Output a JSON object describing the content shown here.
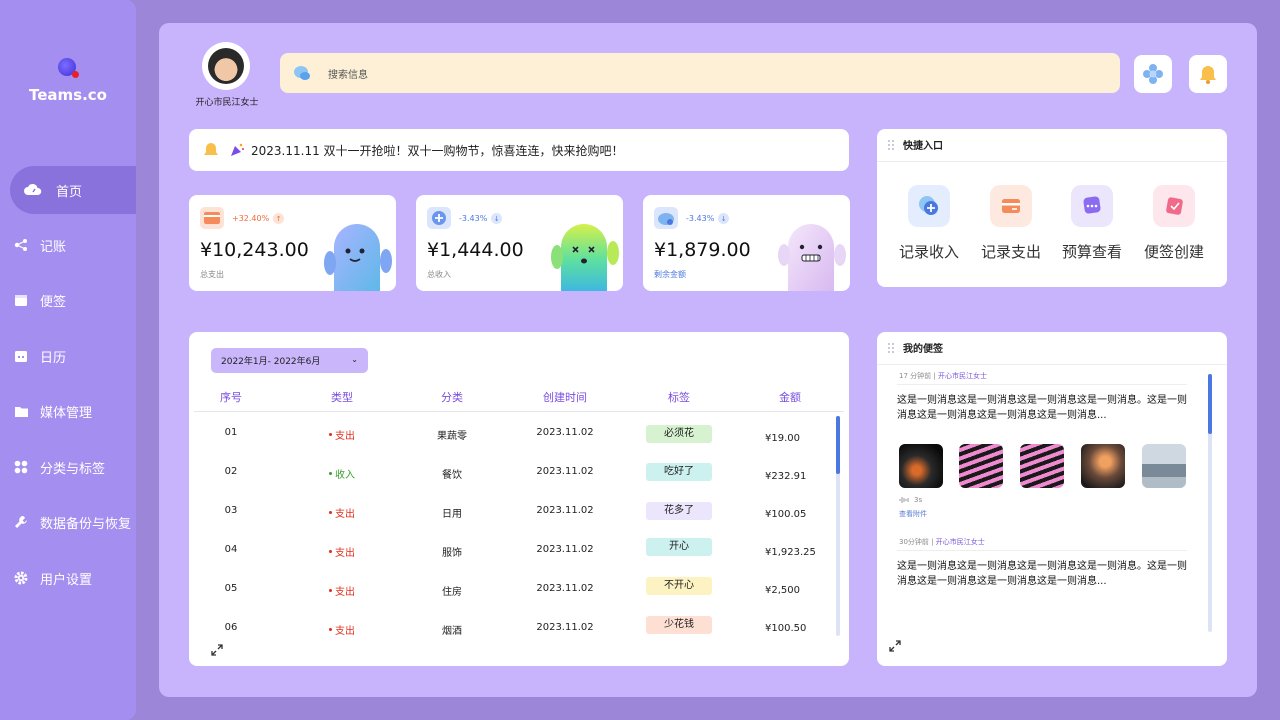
{
  "app": {
    "logo_text": "Teams.co"
  },
  "sidebar": {
    "items": [
      {
        "label": "首页",
        "icon": "cloud-icon",
        "active": true
      },
      {
        "label": "记账",
        "icon": "share-icon"
      },
      {
        "label": "便签",
        "icon": "calendar-icon"
      },
      {
        "label": "日历",
        "icon": "calendar-date-icon"
      },
      {
        "label": "媒体管理",
        "icon": "folder-icon"
      },
      {
        "label": "分类与标签",
        "icon": "grid-icon"
      },
      {
        "label": "数据备份与恢复",
        "icon": "wrench-icon"
      },
      {
        "label": "用户设置",
        "icon": "gear-icon"
      }
    ]
  },
  "header": {
    "user_name": "开心市民江女士",
    "search_placeholder": "搜索信息"
  },
  "notice": {
    "text": "2023.11.11 双十一开抢啦！双十一购物节，惊喜连连，快来抢购吧！"
  },
  "stats": [
    {
      "change": "+32.40%",
      "direction": "up",
      "amount": "¥10,243.00",
      "label": "总支出",
      "accent": "#f26b3a"
    },
    {
      "change": "-3.43%",
      "direction": "down",
      "amount": "¥1,444.00",
      "label": "总收入",
      "accent": "#4a78e0"
    },
    {
      "change": "-3.43%",
      "direction": "down",
      "amount": "¥1,879.00",
      "label": "剩余金额",
      "accent": "#4a78e0"
    }
  ],
  "quick_entry": {
    "title": "快捷入口",
    "items": [
      {
        "label": "记录收入",
        "icon": "add-income-icon"
      },
      {
        "label": "记录支出",
        "icon": "card-icon"
      },
      {
        "label": "预算查看",
        "icon": "chat-dots-icon"
      },
      {
        "label": "便签创建",
        "icon": "note-check-icon"
      }
    ]
  },
  "records": {
    "date_range": "2022年1月- 2022年6月",
    "columns": [
      "序号",
      "类型",
      "分类",
      "创建时间",
      "标签",
      "金额"
    ],
    "rows": [
      {
        "no": "01",
        "type": "支出",
        "category": "果蔬零",
        "time": "2023.11.02",
        "tag": "必须花",
        "tag_color": "#d7f2d0",
        "amount": "¥19.00"
      },
      {
        "no": "02",
        "type": "收入",
        "category": "餐饮",
        "time": "2023.11.02",
        "tag": "吃好了",
        "tag_color": "#cdf1ee",
        "amount": "¥232.91"
      },
      {
        "no": "03",
        "type": "支出",
        "category": "日用",
        "time": "2023.11.02",
        "tag": "花多了",
        "tag_color": "#ece6fc",
        "amount": "¥100.05"
      },
      {
        "no": "04",
        "type": "支出",
        "category": "服饰",
        "time": "2023.11.02",
        "tag": "开心",
        "tag_color": "#cdf1ee",
        "amount": "¥1,923.25"
      },
      {
        "no": "05",
        "type": "支出",
        "category": "住房",
        "time": "2023.11.02",
        "tag": "不开心",
        "tag_color": "#fdf3c2",
        "amount": "¥2,500"
      },
      {
        "no": "06",
        "type": "支出",
        "category": "烟酒",
        "time": "2023.11.02",
        "tag": "少花钱",
        "tag_color": "#fde0d3",
        "amount": "¥100.50"
      }
    ],
    "colors": {
      "expense": "#e0301e",
      "income": "#3aa02c"
    }
  },
  "memos": {
    "title": "我的便签",
    "items": [
      {
        "time": "17 分钟前",
        "author": "开心市民江女士",
        "text": "这是一则消息这是一则消息这是一则消息这是一则消息。这是一则消息这是一则消息这是一则消息这是一则消息...",
        "voice": "3s",
        "attach_label": "查看附件"
      },
      {
        "time": "30分钟前",
        "author": "开心市民江女士",
        "text": "这是一则消息这是一则消息这是一则消息这是一则消息。这是一则消息这是一则消息这是一则消息这是一则消息..."
      }
    ]
  }
}
